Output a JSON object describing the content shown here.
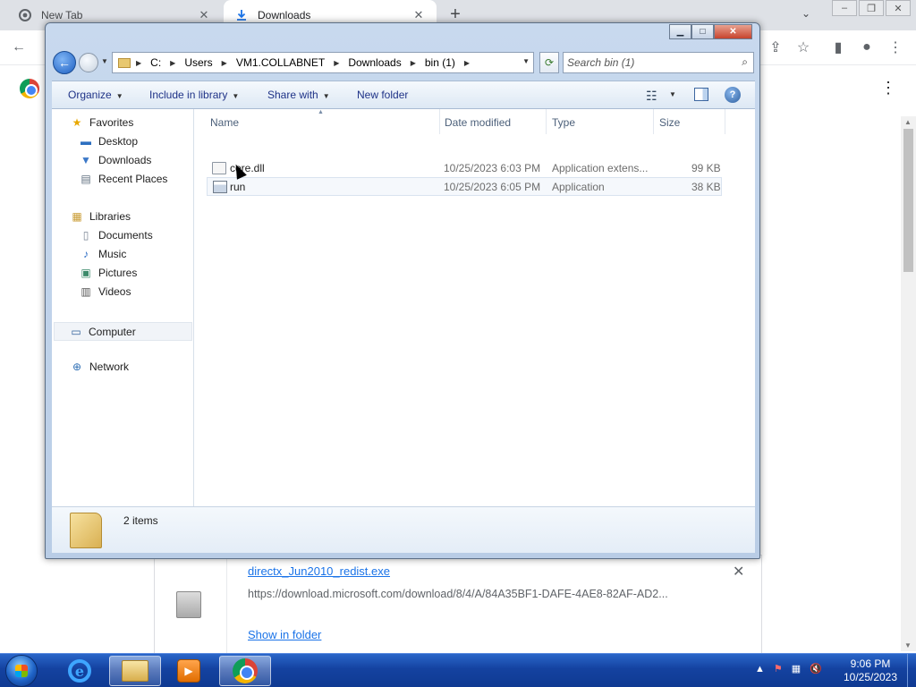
{
  "browser": {
    "tabs": [
      {
        "label": "New Tab",
        "icon": "chrome-icon",
        "active": false
      },
      {
        "label": "Downloads",
        "icon": "download-icon",
        "active": true
      }
    ],
    "download_item": {
      "filename": "directx_Jun2010_redist.exe",
      "url": "https://download.microsoft.com/download/8/4/A/84A35BF1-DAFE-4AE8-82AF-AD2...",
      "show_in_folder": "Show in folder"
    }
  },
  "explorer": {
    "breadcrumb": [
      "C:",
      "Users",
      "VM1.COLLABNET",
      "Downloads",
      "bin (1)"
    ],
    "search_placeholder": "Search bin (1)",
    "commands": {
      "organize": "Organize",
      "include_in_library": "Include in library",
      "share_with": "Share with",
      "new_folder": "New folder"
    },
    "nav": {
      "favorites": "Favorites",
      "desktop": "Desktop",
      "downloads": "Downloads",
      "recent_places": "Recent Places",
      "libraries": "Libraries",
      "documents": "Documents",
      "music": "Music",
      "pictures": "Pictures",
      "videos": "Videos",
      "computer": "Computer",
      "network": "Network"
    },
    "columns": {
      "name": "Name",
      "date_modified": "Date modified",
      "type": "Type",
      "size": "Size"
    },
    "files": [
      {
        "name": "core.dll",
        "date": "10/25/2023 6:03 PM",
        "type": "Application extens...",
        "size": "99 KB"
      },
      {
        "name": "run",
        "date": "10/25/2023 6:05 PM",
        "type": "Application",
        "size": "38 KB"
      }
    ],
    "status": "2 items"
  },
  "taskbar": {
    "clock_time": "9:06 PM",
    "clock_date": "10/25/2023"
  },
  "colors": {
    "taskbar_blue": "#1442a0",
    "link_blue": "#1a73e8",
    "explorer_frame": "#b9cde6"
  }
}
